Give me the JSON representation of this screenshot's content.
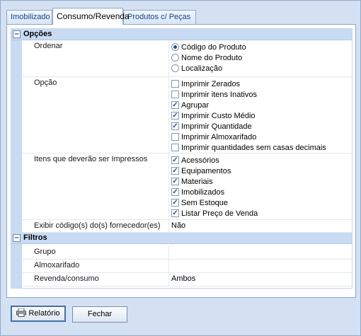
{
  "tabs": [
    "Imobilizado",
    "Consumo/Revenda",
    "Produtos c/ Peças"
  ],
  "categories": {
    "opcoes": "Opções",
    "filtros": "Filtros"
  },
  "toggle_symbol": "–",
  "rows": {
    "ordenar": {
      "label": "Ordenar",
      "options": [
        {
          "label": "Código do Produto",
          "selected": true
        },
        {
          "label": "Nome do Produto",
          "selected": false
        },
        {
          "label": "Localização",
          "selected": false
        }
      ]
    },
    "opcao": {
      "label": "Opção",
      "options": [
        {
          "label": "Imprimir Zerados",
          "checked": false
        },
        {
          "label": "Imprimir itens Inativos",
          "checked": false
        },
        {
          "label": "Agrupar",
          "checked": true
        },
        {
          "label": "Imprimir Custo Médio",
          "checked": true
        },
        {
          "label": "Imprimir Quantidade",
          "checked": true
        },
        {
          "label": "Imprimir Almoxarifado",
          "checked": false
        },
        {
          "label": "Imprimir quantidades sem casas decimais",
          "checked": false
        }
      ]
    },
    "itens": {
      "label": "Itens que deverão ser Impressos",
      "options": [
        {
          "label": "Acessórios",
          "checked": true
        },
        {
          "label": "Equipamentos",
          "checked": true
        },
        {
          "label": "Materiais",
          "checked": true
        },
        {
          "label": "Imobilizados",
          "checked": true
        },
        {
          "label": "Sem Estoque",
          "checked": true
        },
        {
          "label": "Listar Preço de Venda",
          "checked": true
        }
      ]
    },
    "exibir": {
      "label": "Exibir código(s) do(s) fornecedor(es)",
      "value": "Não"
    },
    "grupo": {
      "label": "Grupo",
      "value": ""
    },
    "almoxarifado": {
      "label": "Almoxarifado",
      "value": ""
    },
    "revenda": {
      "label": "Revenda/consumo",
      "value": "Ambos"
    }
  },
  "buttons": {
    "relatorio": "Relatório",
    "fechar": "Fechar"
  },
  "check_mark": "✓"
}
